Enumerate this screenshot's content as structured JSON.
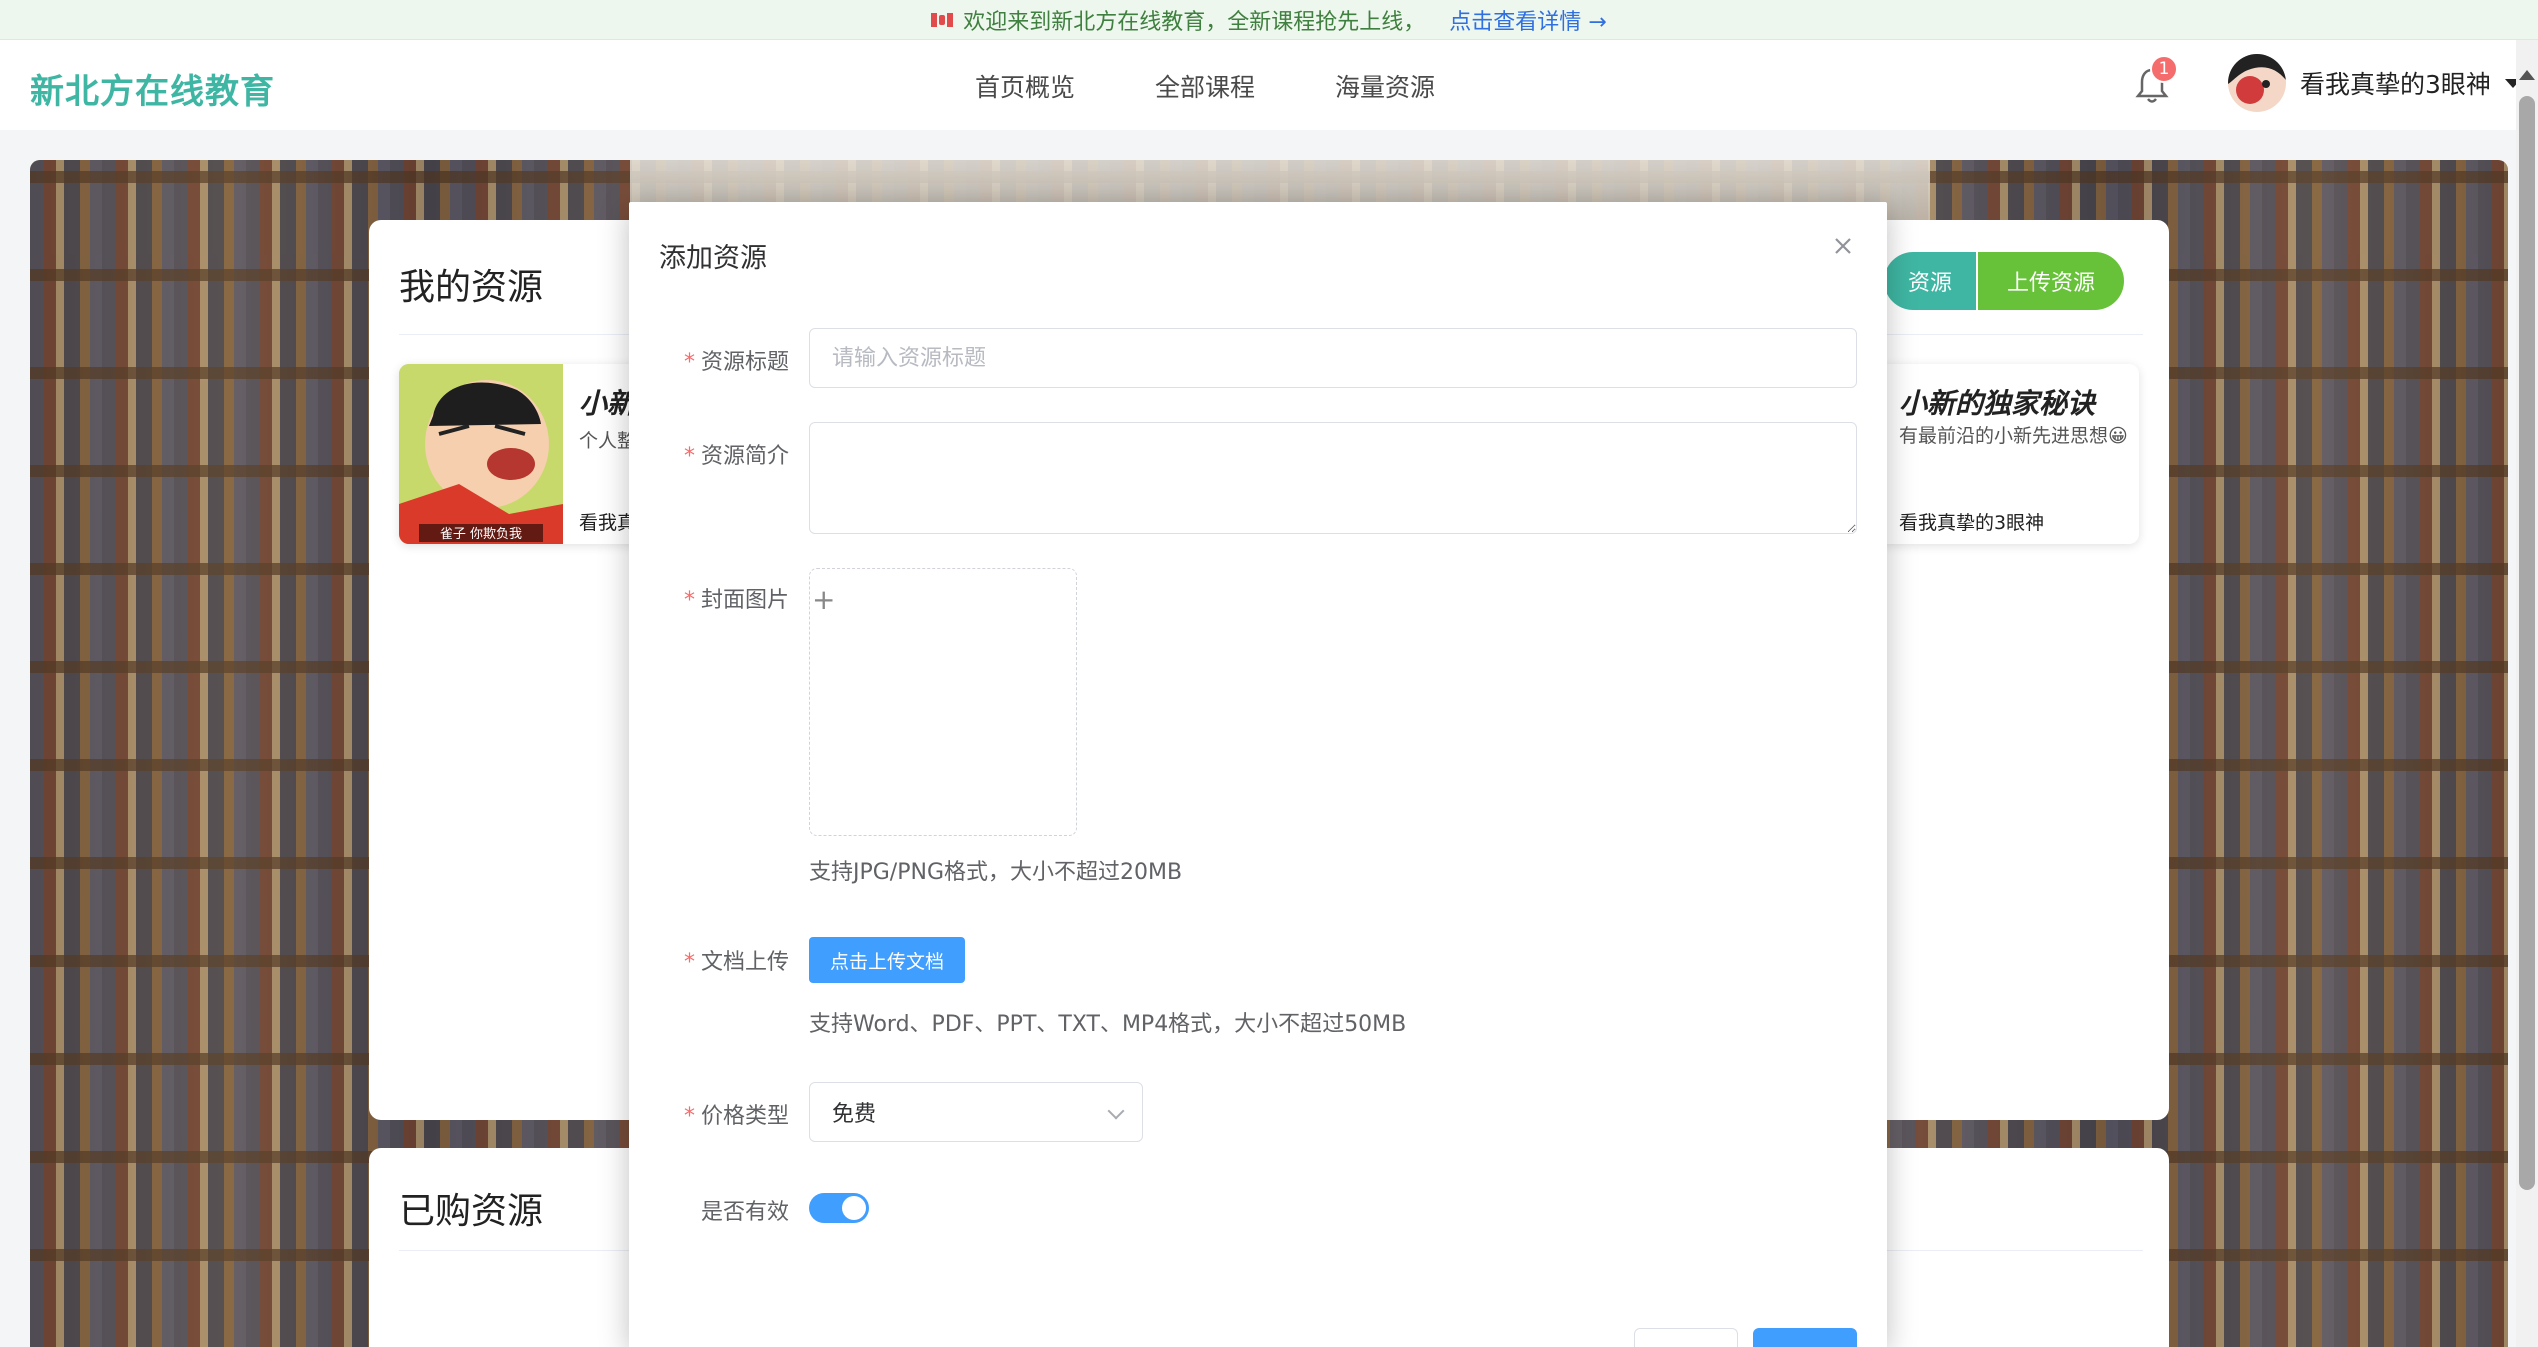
{
  "announcement": {
    "text": "欢迎来到新北方在线教育，全新课程抢先上线，",
    "link": "点击查看详情 →"
  },
  "header": {
    "brand": "新北方在线教育",
    "nav": [
      "首页概览",
      "全部课程",
      "海量资源"
    ],
    "notification_count": "1",
    "username": "看我真挚的3眼神"
  },
  "my_resources": {
    "title": "我的资源",
    "buttons": {
      "resources": "资源",
      "upload": "上传资源"
    },
    "cards": [
      {
        "title": "小新",
        "desc": "个人整",
        "author": "看我真",
        "thumb_caption": "雀子 你欺负我"
      },
      {
        "title": "小新的独家秘诀",
        "desc": "有最前沿的小新先进思想😀",
        "author": "看我真挚的3眼神"
      }
    ]
  },
  "purchased": {
    "title": "已购资源"
  },
  "dialog": {
    "title": "添加资源",
    "fields": {
      "title_label": "资源标题",
      "title_placeholder": "请输入资源标题",
      "intro_label": "资源简介",
      "cover_label": "封面图片",
      "cover_hint": "支持JPG/PNG格式，大小不超过20MB",
      "doc_label": "文档上传",
      "doc_button": "点击上传文档",
      "doc_hint": "支持Word、PDF、PPT、TXT、MP4格式，大小不超过50MB",
      "price_label": "价格类型",
      "price_value": "免费",
      "valid_label": "是否有效",
      "valid_value": true
    }
  },
  "colors": {
    "brand": "#3fb6a3",
    "primary": "#409eff",
    "success": "#67c23a",
    "required": "#f56c6c"
  }
}
